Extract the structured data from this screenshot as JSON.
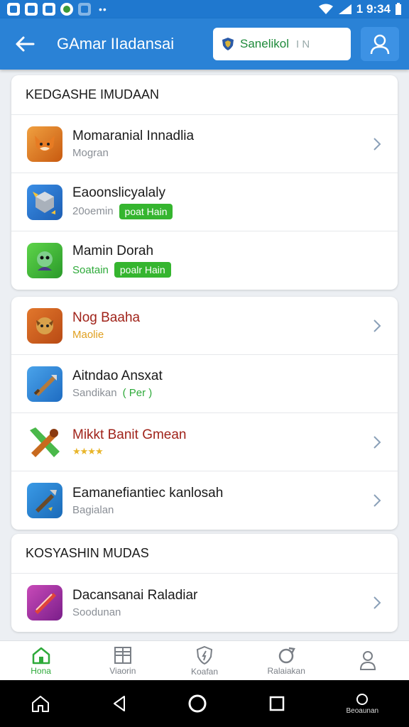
{
  "status_bar": {
    "time": "1 9:34",
    "signal": "4"
  },
  "app_bar": {
    "title": "GAmar IIadansai",
    "search_value": "Sanelikol",
    "search_cursor": "I N",
    "back_icon": "back-arrow-icon",
    "profile_icon": "user-icon"
  },
  "sections": [
    {
      "title": "KEDGASHE IMUDAAN",
      "items": [
        {
          "name": "Momaranial Innadlia",
          "sub": "Mogran",
          "badge": "",
          "icon": "fox-icon",
          "chevron": true
        },
        {
          "name": "Eaoonslicyalaly",
          "sub": "20oemin",
          "badge": "poat Hain",
          "icon": "cube-icon",
          "chevron": false
        },
        {
          "name": "Mamin Dorah",
          "sub": "Soatain",
          "badge": "poalr Hain",
          "icon": "goblin-icon",
          "chevron": false
        }
      ]
    },
    {
      "title": "",
      "items": [
        {
          "name": "Nog Baaha",
          "sub": "Maolie",
          "badge": "",
          "icon": "monster-icon",
          "chevron": true
        },
        {
          "name": "Aitndao Ansxat",
          "sub": "Sandikan",
          "sub_extra": "( Per )",
          "badge": "",
          "icon": "sword-icon",
          "chevron": false
        },
        {
          "name": "Mikkt Banit Gmean",
          "sub": "★★★★",
          "badge": "",
          "icon": "hammer-icon",
          "chevron": true
        },
        {
          "name": "Eamanefiantiec kanlosah",
          "sub": "Bagialan",
          "badge": "",
          "icon": "dagger-icon",
          "chevron": true
        }
      ]
    },
    {
      "title": "KOSYASHIN MUDAS",
      "items": [
        {
          "name": "Dacansanai Raladiar",
          "sub": "Soodunan",
          "badge": "",
          "icon": "gem-icon",
          "chevron": true
        }
      ]
    }
  ],
  "bottom_nav": [
    {
      "label": "Hona",
      "icon": "home-icon",
      "active": true
    },
    {
      "label": "Viaorin",
      "icon": "grid-icon",
      "active": false
    },
    {
      "label": "Koafan",
      "icon": "shield-icon",
      "active": false
    },
    {
      "label": "Ralaiakan",
      "icon": "refresh-icon",
      "active": false
    },
    {
      "label": "",
      "icon": "profile-icon",
      "active": false
    }
  ],
  "system_nav": {
    "extra_label": "Beoaunan"
  },
  "colors": {
    "primary": "#2a82d6",
    "status_bar": "#1f78cf",
    "green": "#35b52f",
    "red_text": "#a0231a"
  }
}
